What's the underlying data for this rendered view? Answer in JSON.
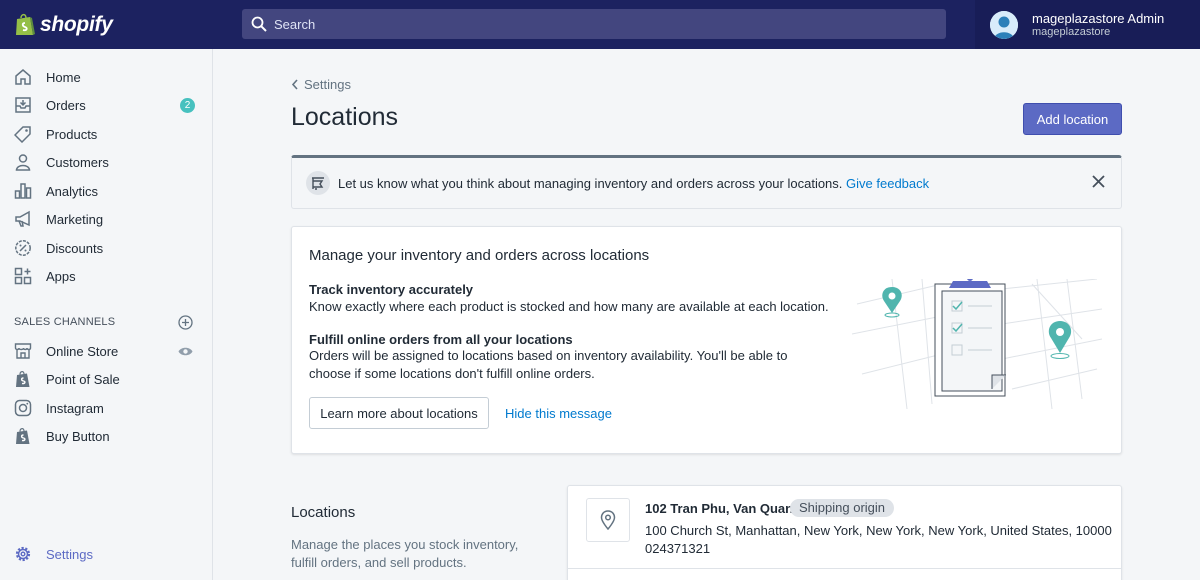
{
  "brand": {
    "name": "shopify"
  },
  "search": {
    "placeholder": "Search"
  },
  "user": {
    "name": "mageplazastore Admin",
    "store": "mageplazastore"
  },
  "sidebar": {
    "items": [
      {
        "label": "Home",
        "icon": "home-icon"
      },
      {
        "label": "Orders",
        "icon": "orders-icon",
        "badge": "2"
      },
      {
        "label": "Products",
        "icon": "tag-icon"
      },
      {
        "label": "Customers",
        "icon": "person-icon"
      },
      {
        "label": "Analytics",
        "icon": "bar-chart-icon"
      },
      {
        "label": "Marketing",
        "icon": "megaphone-icon"
      },
      {
        "label": "Discounts",
        "icon": "discount-icon"
      },
      {
        "label": "Apps",
        "icon": "apps-icon"
      }
    ],
    "sales_channels_heading": "SALES CHANNELS",
    "channels": [
      {
        "label": "Online Store",
        "icon": "store-icon"
      },
      {
        "label": "Point of Sale",
        "icon": "shopify-bag-icon"
      },
      {
        "label": "Instagram",
        "icon": "instagram-icon"
      },
      {
        "label": "Buy Button",
        "icon": "shopify-bag-icon"
      }
    ],
    "settings_label": "Settings"
  },
  "breadcrumb": {
    "label": "Settings"
  },
  "page": {
    "title": "Locations",
    "add_button": "Add location"
  },
  "banner": {
    "text": "Let us know what you think about managing inventory and orders across your locations.",
    "link": "Give feedback"
  },
  "intro": {
    "title": "Manage your inventory and orders across locations",
    "h1": "Track inventory accurately",
    "p1": "Know exactly where each product is stocked and how many are available at each location.",
    "h2": "Fulfill online orders from all your locations",
    "p2": "Orders will be assigned to locations based on inventory availability. You'll be able to choose if some locations don't fulfill online orders.",
    "learn_more": "Learn more about locations",
    "hide": "Hide this message"
  },
  "locations_section": {
    "heading": "Locations",
    "description": "Manage the places you stock inventory, fulfill orders, and sell products."
  },
  "location": {
    "name": "102 Tran Phu, Van Quan",
    "badge": "Shipping origin",
    "address": "100 Church St, Manhattan, New York, New York, New York, United States, 10000",
    "phone": "024371321"
  },
  "colors": {
    "primary": "#5c6ac4",
    "topbar": "#1c2260",
    "link": "#007ace",
    "accent": "#47c1bf"
  }
}
